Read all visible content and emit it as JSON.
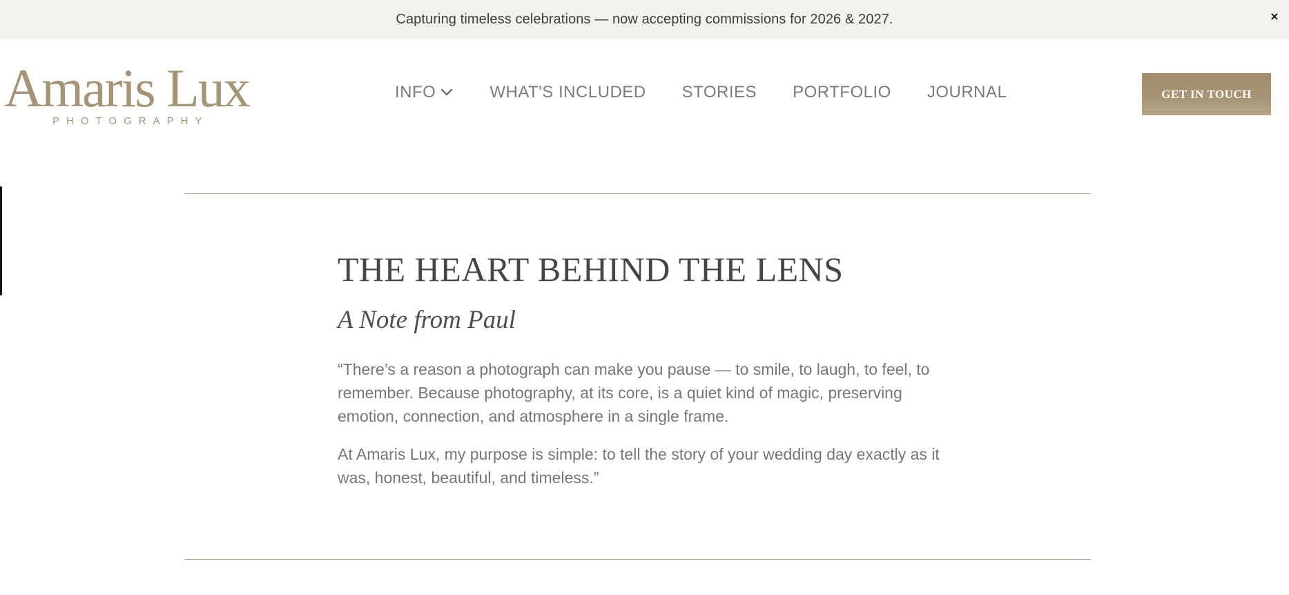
{
  "announcement": {
    "text": "Capturing timeless celebrations — now accepting commissions for 2026 & 2027.",
    "close_label": "×"
  },
  "brand": {
    "name": "Amaris Lux",
    "tagline": "PHOTOGRAPHY"
  },
  "nav": {
    "items": [
      {
        "label": "INFO",
        "icon": "chevron-down-icon"
      },
      {
        "label": "WHAT'S INCLUDED"
      },
      {
        "label": "STORIES"
      },
      {
        "label": "PORTFOLIO"
      },
      {
        "label": "JOURNAL"
      }
    ]
  },
  "cta": {
    "label": "GET IN TOUCH"
  },
  "section": {
    "title": "THE HEART BEHIND THE LENS",
    "subtitle": "A Note from Paul",
    "paragraphs": [
      "“There’s a reason a photograph can make you pause — to smile, to laugh, to feel, to remember.   Because photography, at its core, is a quiet kind of magic, preserving emotion, connection, and atmosphere in a single frame.",
      "At Amaris Lux, my purpose is simple: to tell the story of your wedding day exactly as it was, honest, beautiful, and timeless.”"
    ]
  },
  "colors": {
    "accent": "#a59576",
    "announcement_bg": "#f2f1ec",
    "rule": "#b7ab92",
    "heading": "#44474a",
    "body_text": "#74767a",
    "nav_text": "#7a7b7d"
  }
}
